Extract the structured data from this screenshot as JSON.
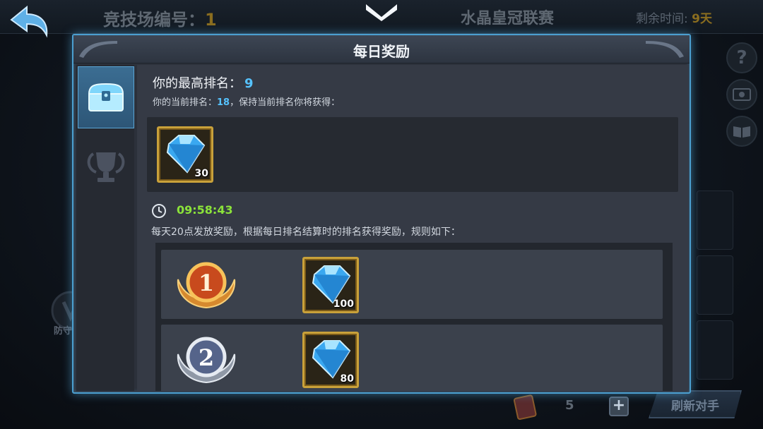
{
  "background": {
    "arena_label": "竞技场编号：",
    "arena_number": "1",
    "league_title": "水晶皇冠联赛",
    "time_left_label": "剩余时间:",
    "time_left_value": "9天",
    "defense_label": "防守",
    "token_count": "5",
    "plus_label": "+",
    "refresh_label": "刷新对手",
    "help_label": "?"
  },
  "modal": {
    "title": "每日奖励",
    "tabs": [
      {
        "name": "reward-chest",
        "active": true
      },
      {
        "name": "trophy",
        "active": false
      }
    ],
    "best_rank_label": "你的最高排名：",
    "best_rank_value": "9",
    "current_rank_prefix": "你的当前排名：",
    "current_rank_value": "18",
    "current_rank_suffix": "，保持当前排名你将获得：",
    "current_reward": {
      "icon": "blue-gem-icon",
      "qty": "30"
    },
    "countdown": "09:58:43",
    "rule_text": "每天20点发放奖励，根据每日排名结算时的排名获得奖励，规则如下：",
    "rank_rewards": [
      {
        "rank": "1",
        "medal": "gold",
        "icon": "blue-gem-icon",
        "qty": "100"
      },
      {
        "rank": "2",
        "medal": "silver",
        "icon": "blue-gem-icon",
        "qty": "80"
      }
    ]
  },
  "colors": {
    "accent_blue": "#56c3ff",
    "countdown_green": "#8be33a",
    "modal_border": "#4b9fd0",
    "item_frame_gold": "#c9a13a"
  }
}
